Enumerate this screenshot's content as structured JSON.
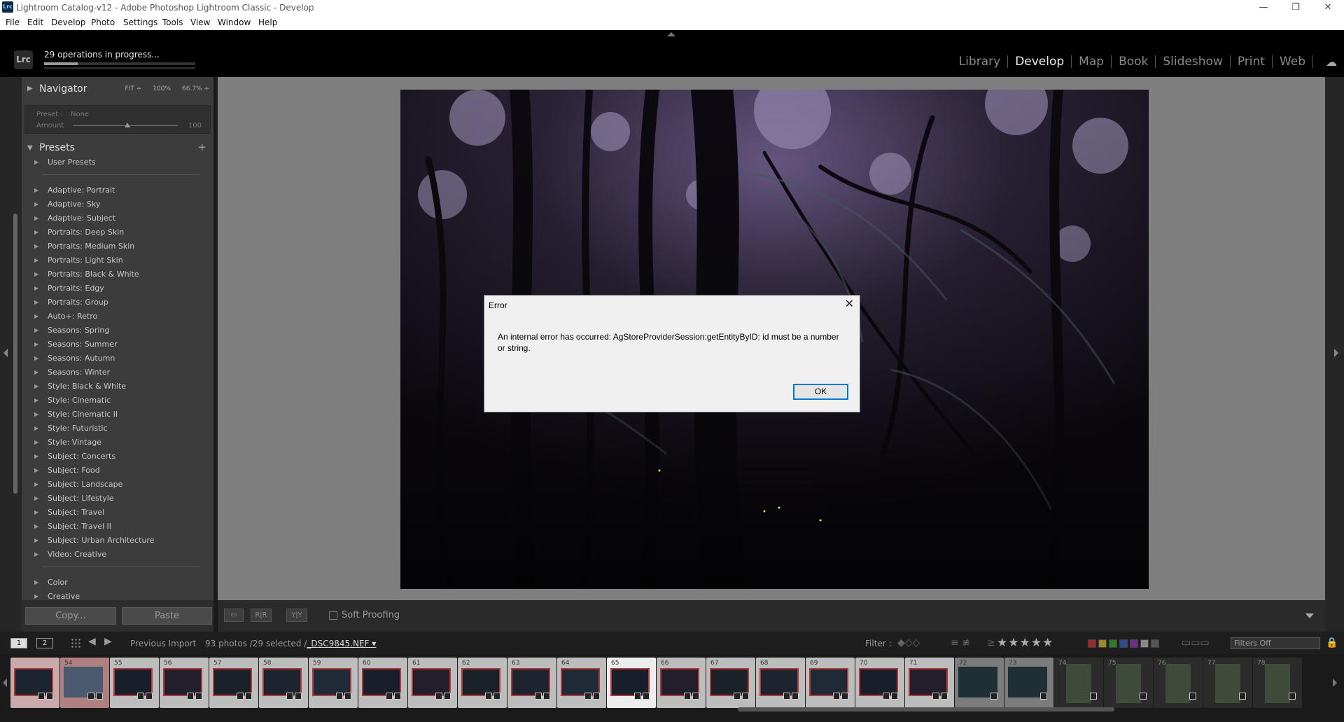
{
  "window": {
    "title": "Lightroom Catalog-v12 - Adobe Photoshop Lightroom Classic - Develop",
    "badge": "Lrc"
  },
  "menu": [
    "File",
    "Edit",
    "Develop",
    "Photo",
    "Settings",
    "Tools",
    "View",
    "Window",
    "Help"
  ],
  "identity": {
    "logo": "Lrc",
    "operations": "29 operations in progress...",
    "progress": 0.22
  },
  "modules": [
    {
      "label": "Library",
      "active": false
    },
    {
      "label": "Develop",
      "active": true
    },
    {
      "label": "Map",
      "active": false
    },
    {
      "label": "Book",
      "active": false
    },
    {
      "label": "Slideshow",
      "active": false
    },
    {
      "label": "Print",
      "active": false
    },
    {
      "label": "Web",
      "active": false
    }
  ],
  "navigator": {
    "title": "Navigator",
    "fit": "FIT ÷",
    "z1": "100%",
    "z2": "66.7% ÷"
  },
  "preset_amount": {
    "preset_label": "Preset :",
    "preset_value": "None",
    "amount_label": "Amount",
    "amount_value": "100"
  },
  "presets": {
    "title": "Presets",
    "user": "User Presets",
    "groups": [
      "Adaptive: Portrait",
      "Adaptive: Sky",
      "Adaptive: Subject",
      "Portraits: Deep Skin",
      "Portraits: Medium Skin",
      "Portraits: Light Skin",
      "Portraits: Black & White",
      "Portraits: Edgy",
      "Portraits: Group",
      "Auto+: Retro",
      "Seasons: Spring",
      "Seasons: Summer",
      "Seasons: Autumn",
      "Seasons: Winter",
      "Style: Black & White",
      "Style: Cinematic",
      "Style: Cinematic II",
      "Style: Futuristic",
      "Style: Vintage",
      "Subject: Concerts",
      "Subject: Food",
      "Subject: Landscape",
      "Subject: Lifestyle",
      "Subject: Travel",
      "Subject: Travel II",
      "Subject: Urban Architecture",
      "Video: Creative"
    ],
    "more": [
      "Color",
      "Creative"
    ]
  },
  "buttons": {
    "copy": "Copy...",
    "paste": "Paste"
  },
  "toolbar": {
    "soft_proofing": "Soft Proofing",
    "before_after": "R|R",
    "yy": "Y|Y"
  },
  "filmstrip": {
    "monitor1": "1",
    "monitor2": "2",
    "source": "Previous Import",
    "info": "93 photos /29 selected /",
    "file": "_DSC9845.NEF ▾",
    "filter_label": "Filter :",
    "filters_value": "Filters Off",
    "stars": "★★★★★",
    "cells": [
      "",
      "54",
      "55",
      "56",
      "57",
      "58",
      "59",
      "60",
      "61",
      "62",
      "63",
      "64",
      "65",
      "66",
      "67",
      "68",
      "69",
      "70",
      "71",
      "72",
      "73",
      "74",
      "75",
      "76",
      "77",
      "78"
    ]
  },
  "dialog": {
    "title": "Error",
    "message": "An internal error has occurred: AgStoreProviderSession:getEntityByID: id must be a number or string.",
    "ok": "OK"
  }
}
